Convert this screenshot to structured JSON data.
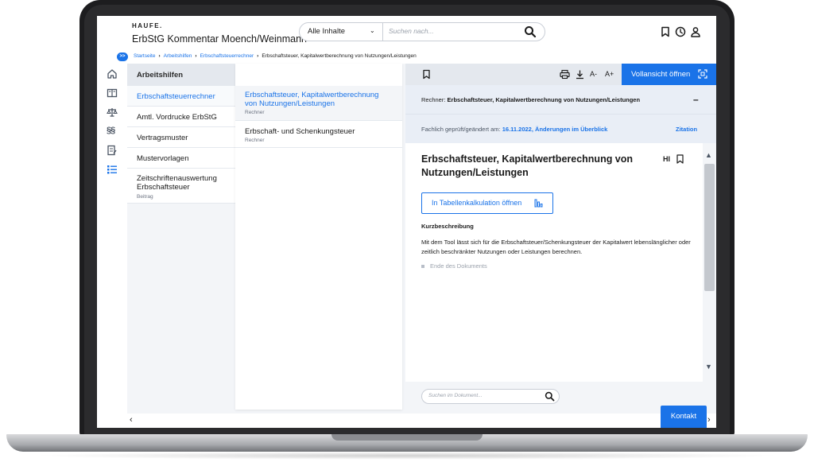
{
  "header": {
    "brand": "HAUFE.",
    "product_title": "ErbStG Kommentar Moench/Weinmann",
    "search": {
      "scope": "Alle Inhalte",
      "placeholder": "Suchen nach..."
    },
    "icons": [
      "bookmark-icon",
      "history-icon",
      "user-icon"
    ]
  },
  "breadcrumb": {
    "toggle": ">>",
    "items": [
      "Startseite",
      "Arbeitshilfen",
      "Erbschaftsteuerrechner"
    ],
    "current": "Erbschaftsteuer, Kapitalwertberechnung von Nutzungen/Leistungen"
  },
  "rail": {
    "icons": [
      "home-icon",
      "book-icon",
      "scales-icon",
      "paragraph-icon",
      "form-icon",
      "list-icon"
    ]
  },
  "nav": {
    "heading": "Arbeitshilfen",
    "items": [
      {
        "label": "Erbschaftsteuerrechner",
        "sub": ""
      },
      {
        "label": "Amtl. Vordrucke ErbStG",
        "sub": ""
      },
      {
        "label": "Vertragsmuster",
        "sub": ""
      },
      {
        "label": "Mustervorlagen",
        "sub": ""
      },
      {
        "label": "Zeitschriftenauswertung Erbschaftsteuer",
        "sub": "Beitrag"
      }
    ]
  },
  "results": [
    {
      "title": "Erbschaftsteuer, Kapitalwertberechnung von Nutzungen/Leistungen",
      "sub": "Rechner"
    },
    {
      "title": "Erbschaft- und Schenkungsteuer",
      "sub": "Rechner"
    }
  ],
  "toolbar": {
    "font_smaller": "A-",
    "font_larger": "A+",
    "full_view": "Vollansicht öffnen"
  },
  "doc": {
    "calc_label": "Rechner:",
    "calc_name": "Erbschaftsteuer, Kapitalwertberechnung von Nutzungen/Leistungen",
    "collapse": "–",
    "meta_prefix": "Fachlich geprüft/geändert am:",
    "meta_date": "16.11.2022,",
    "meta_link": "Änderungen im Überblick",
    "citation": "Zitation",
    "title": "Erbschaftsteuer, Kapitalwertberechnung von Nutzungen/Leistungen",
    "hi": "HI",
    "sheet_button": "In Tabellenkalkulation öffnen",
    "section_heading": "Kurzbeschreibung",
    "section_text": "Mit dem Tool lässt sich für die Erbschaftsteuer/Schenkungsteuer der Kapitalwert lebenslänglicher oder zeitlich beschränkter Nutzungen oder Leistungen berechnen.",
    "end_text": "Ende des Dokuments",
    "search_placeholder": "Suchen im Dokument..."
  },
  "contact": "Kontakt",
  "colors": {
    "accent": "#1a73e8",
    "panel_bg": "#e9eef6",
    "toolbar_bg": "#e4e8ee"
  }
}
